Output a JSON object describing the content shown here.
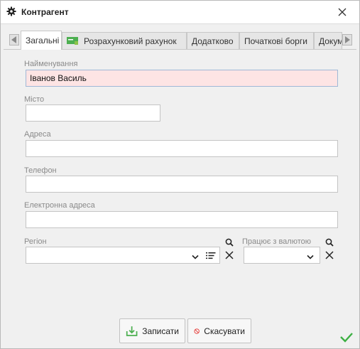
{
  "window": {
    "title": "Контрагент"
  },
  "tabs": [
    {
      "label": "Загальні",
      "active": true
    },
    {
      "label": "Розрахунковий рахунок",
      "icon": "bank-account-icon"
    },
    {
      "label": "Додатково"
    },
    {
      "label": "Початкові борги"
    },
    {
      "label": "Докум"
    }
  ],
  "form": {
    "name_label": "Найменування",
    "name_value": "Іванов Василь",
    "city_label": "Місто",
    "city_value": "",
    "address_label": "Адреса",
    "address_value": "",
    "phone_label": "Телефон",
    "phone_value": "",
    "email_label": "Електронна адреса",
    "email_value": "",
    "region_label": "Регіон",
    "region_value": "",
    "currency_label": "Працює з валютою",
    "currency_value": ""
  },
  "buttons": {
    "save_label": "Записати",
    "cancel_label": "Скасувати"
  },
  "colors": {
    "required_bg": "#fde4e4",
    "save_green": "#4caf50",
    "cancel_red": "#e53935",
    "ok_green": "#3cb043"
  }
}
